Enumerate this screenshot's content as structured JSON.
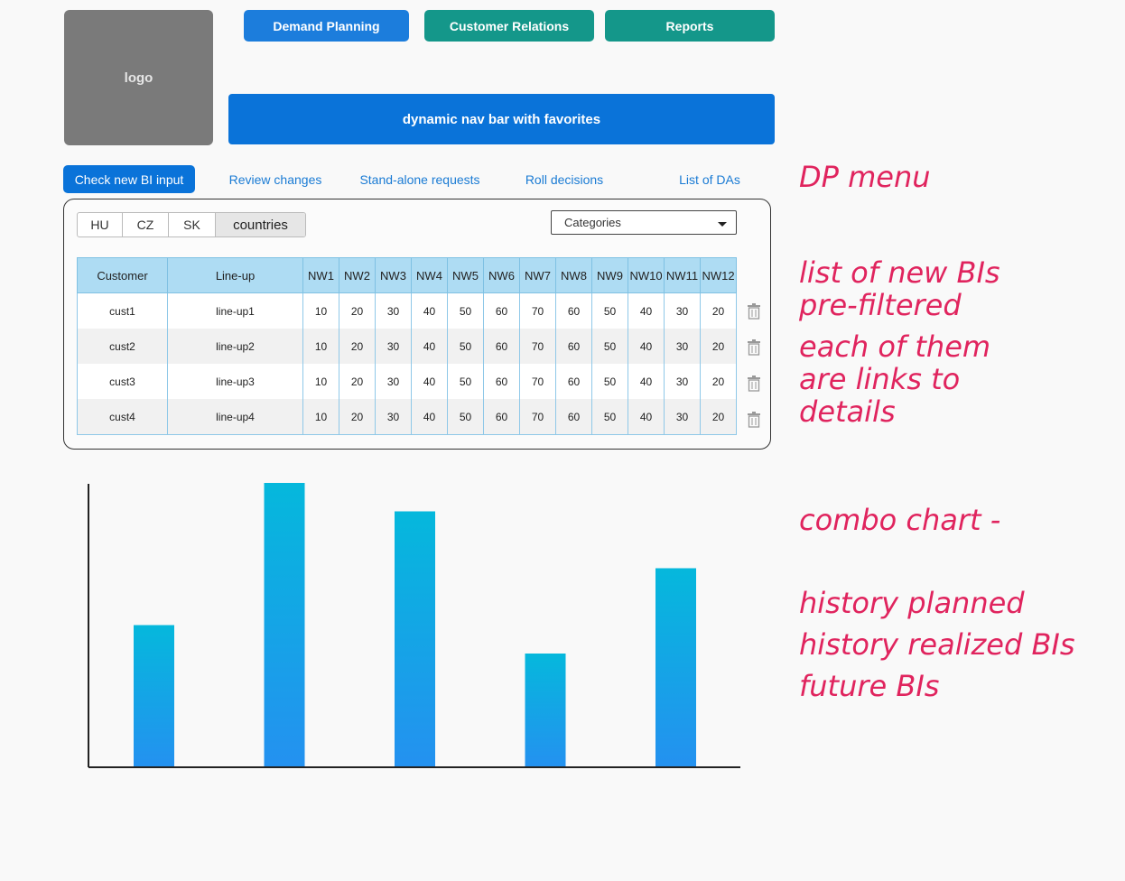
{
  "logo": {
    "label": "logo"
  },
  "top_menu": {
    "items": [
      "Demand Planning",
      "Customer Relations",
      "Reports"
    ]
  },
  "navbar": {
    "label": "dynamic nav bar with favorites"
  },
  "dp_menu": {
    "items": [
      "Check new BI input",
      "Review changes",
      "Stand-alone requests",
      "Roll decisions",
      "List of DAs"
    ],
    "active_index": 0
  },
  "countries": {
    "options": [
      "HU",
      "CZ",
      "SK",
      "countries"
    ]
  },
  "categories_select": {
    "value": "Categories"
  },
  "table": {
    "headers": [
      "Customer",
      "Line-up",
      "NW1",
      "NW2",
      "NW3",
      "NW4",
      "NW5",
      "NW6",
      "NW7",
      "NW8",
      "NW9",
      "NW10",
      "NW11",
      "NW12"
    ],
    "rows": [
      [
        "cust1",
        "line-up1",
        "10",
        "20",
        "30",
        "40",
        "50",
        "60",
        "70",
        "60",
        "50",
        "40",
        "30",
        "20"
      ],
      [
        "cust2",
        "line-up2",
        "10",
        "20",
        "30",
        "40",
        "50",
        "60",
        "70",
        "60",
        "50",
        "40",
        "30",
        "20"
      ],
      [
        "cust3",
        "line-up3",
        "10",
        "20",
        "30",
        "40",
        "50",
        "60",
        "70",
        "60",
        "50",
        "40",
        "30",
        "20"
      ],
      [
        "cust4",
        "line-up4",
        "10",
        "20",
        "30",
        "40",
        "50",
        "60",
        "70",
        "60",
        "50",
        "40",
        "30",
        "20"
      ]
    ]
  },
  "notes": {
    "dp_menu": "DP menu",
    "list_line1": "list of new BIs",
    "list_line2": "pre-filtered",
    "links_line1": "each of them",
    "links_line2": "are links to",
    "links_line3": "details",
    "combo": "combo chart -",
    "history_planned": "history planned",
    "history_realized": "history realized BIs",
    "future": "future BIs"
  },
  "colors": {
    "primary": "#0a73d9",
    "teal": "#14978a",
    "annotation": "#e0245e",
    "bar_top": "#05b8dc",
    "bar_bottom": "#2491f0"
  },
  "chart_data": {
    "type": "bar",
    "values": [
      50,
      100,
      90,
      40,
      70
    ],
    "ylim": [
      0,
      100
    ]
  }
}
